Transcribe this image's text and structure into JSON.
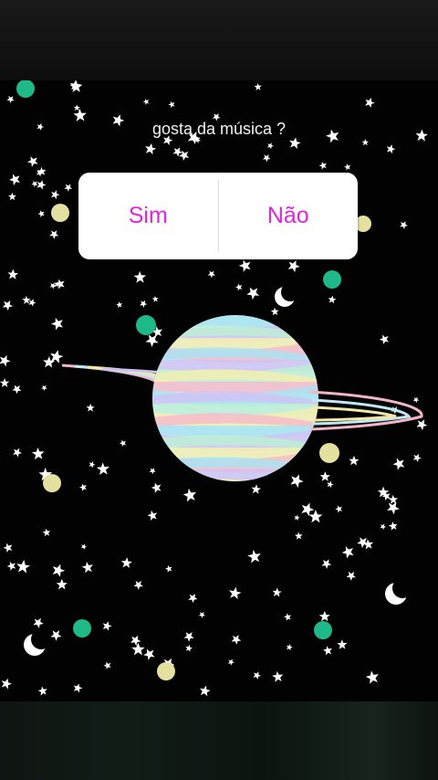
{
  "poll": {
    "question": "gosta da música ?",
    "options": [
      "Sim",
      "Não"
    ],
    "option_color": "#e025e0"
  },
  "scene": {
    "background": "#020202",
    "planet_colors": [
      "#f7b9c9",
      "#a6e3f3",
      "#cfc2f4",
      "#bdf0d3",
      "#f5efae"
    ],
    "dot_colors": [
      "#1fb889",
      "#e4e0a0"
    ],
    "icons": [
      "star-icon",
      "moon-icon",
      "planet-icon"
    ]
  }
}
